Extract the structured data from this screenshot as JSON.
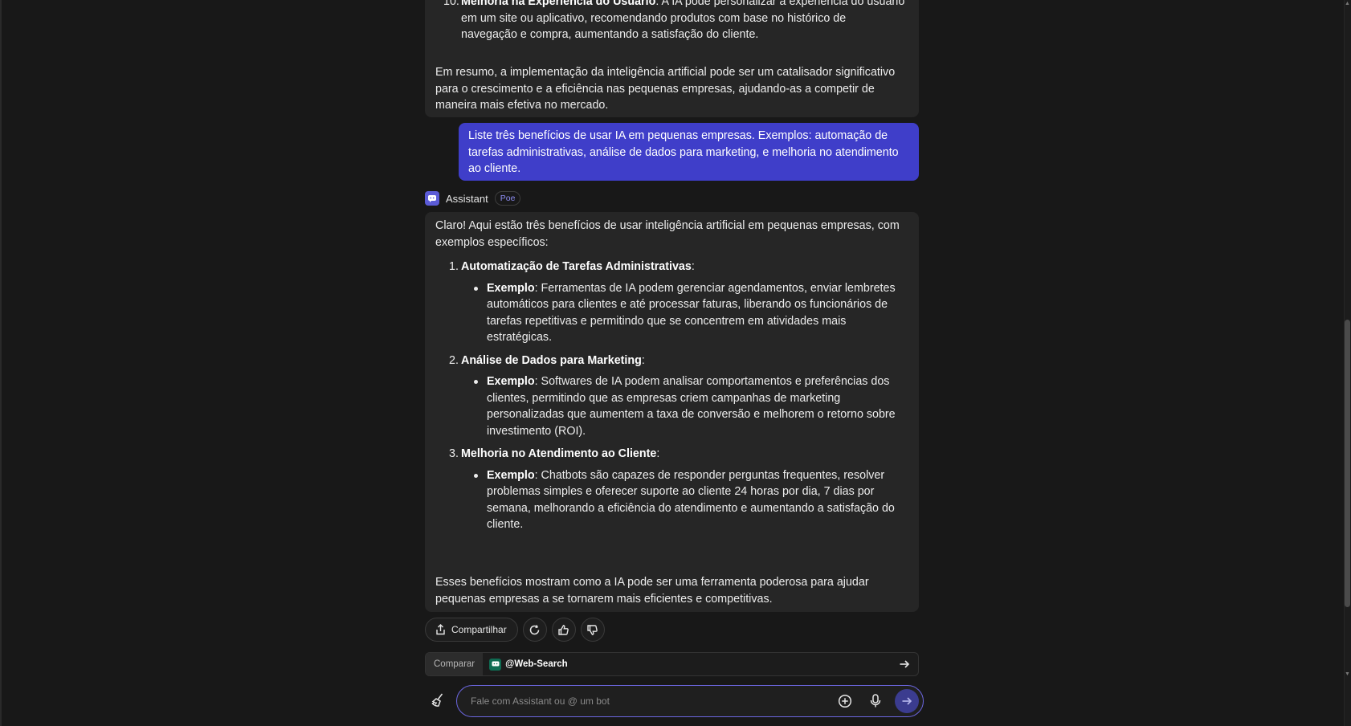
{
  "previous_answer": {
    "item10": {
      "number": "10.",
      "title": "Melhoria na Experiência do Usuário",
      "text": ": A IA pode personalizar a experiência do usuário",
      "line2": "em um site ou aplicativo, recomendando produtos com base no histórico de",
      "line3": "navegação e compra, aumentando a satisfação do cliente."
    },
    "summary": "Em resumo, a implementação da inteligência artificial pode ser um catalisador significativo para o crescimento e a eficiência nas pequenas empresas, ajudando-as a competir de maneira mais efetiva no mercado."
  },
  "user_message": "Liste três benefícios de usar IA em pequenas empresas. Exemplos: automação de tarefas administrativas, análise de dados para marketing, e melhoria no atendimento ao cliente.",
  "assistant": {
    "name": "Assistant",
    "badge": "Poe",
    "intro": "Claro! Aqui estão três benefícios de usar inteligência artificial em pequenas empresas, com exemplos específicos:",
    "items": [
      {
        "number": "1.",
        "title": "Automatização de Tarefas Administrativas",
        "colon": ":",
        "example_label": "Exemplo",
        "example_text": ": Ferramentas de IA podem gerenciar agendamentos, enviar lembretes automáticos para clientes e até processar faturas, liberando os funcionários de tarefas repetitivas e permitindo que se concentrem em atividades mais estratégicas."
      },
      {
        "number": "2.",
        "title": "Análise de Dados para Marketing",
        "colon": ":",
        "example_label": "Exemplo",
        "example_text": ": Softwares de IA podem analisar comportamentos e preferências dos clientes, permitindo que as empresas criem campanhas de marketing personalizadas que aumentem a taxa de conversão e melhorem o retorno sobre investimento (ROI)."
      },
      {
        "number": "3.",
        "title": "Melhoria no Atendimento ao Cliente",
        "colon": ":",
        "example_label": "Exemplo",
        "example_text": ": Chatbots são capazes de responder perguntas frequentes, resolver problemas simples e oferecer suporte ao cliente 24 horas por dia, 7 dias por semana, melhorando a eficiência do atendimento e aumentando a satisfação do cliente."
      }
    ],
    "outro": "Esses benefícios mostram como a IA pode ser uma ferramenta poderosa para ajudar pequenas empresas a se tornarem mais eficientes e competitivas."
  },
  "actions": {
    "share_label": "Compartilhar",
    "share_icon": "share-icon",
    "retry_icon": "refresh-icon",
    "like_icon": "thumbs-up-icon",
    "dislike_icon": "thumbs-down-icon"
  },
  "compare": {
    "label": "Comparar",
    "bot": "@Web-Search"
  },
  "composer": {
    "placeholder": "Fale com Assistant ou @ um bot"
  },
  "colors": {
    "user_bubble": "#3f3ec9",
    "assistant_bubble": "#262626",
    "accent": "#6b66e0"
  }
}
